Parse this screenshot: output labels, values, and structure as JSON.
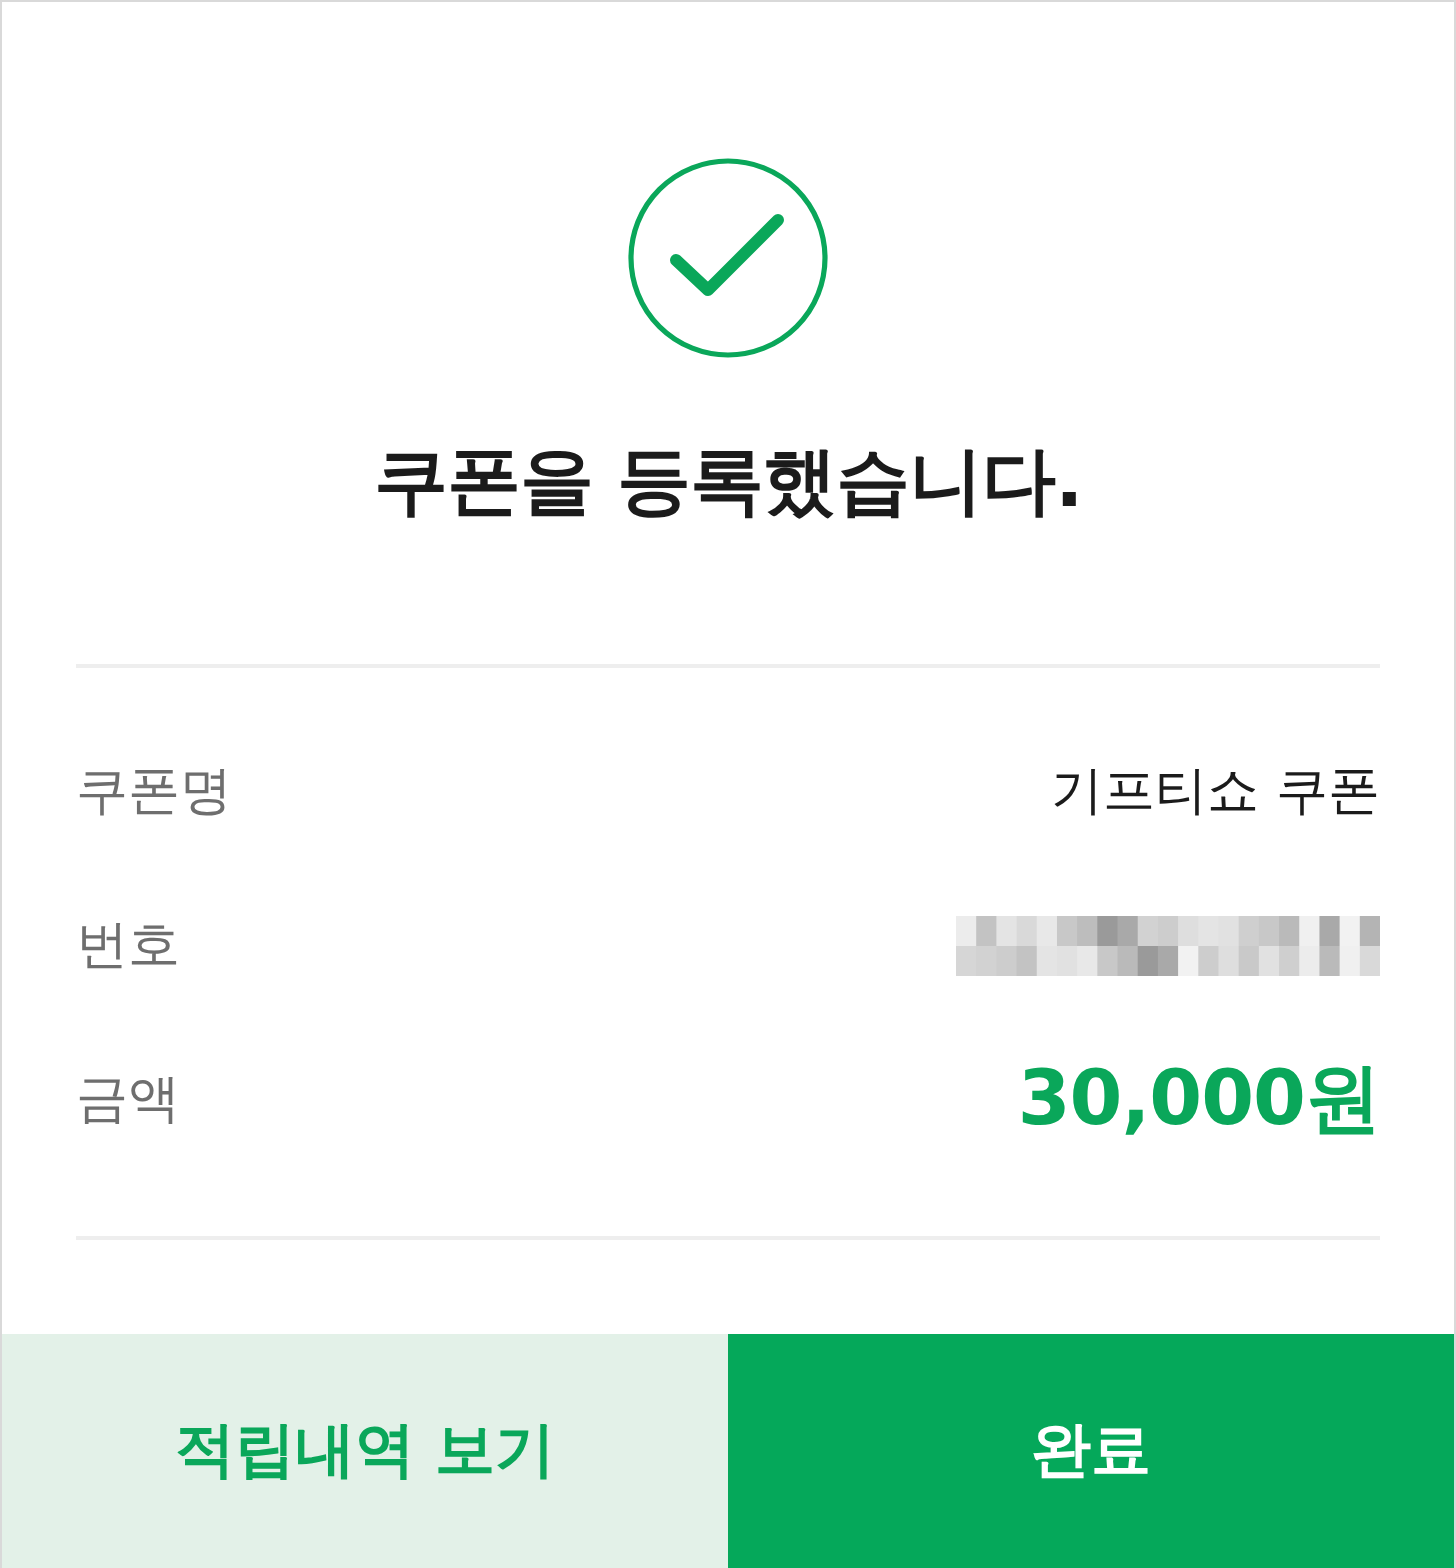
{
  "title": "쿠폰을 등록했습니다.",
  "details": [
    {
      "label": "쿠폰명",
      "kind": "text",
      "value": "기프티쇼 쿠폰"
    },
    {
      "label": "번호",
      "kind": "masked"
    },
    {
      "label": "금액",
      "kind": "amount",
      "value": "30,000원"
    }
  ],
  "buttons": [
    {
      "label": "적립내역 보기",
      "kind": "secondary"
    },
    {
      "label": "완료",
      "kind": "primary"
    }
  ]
}
